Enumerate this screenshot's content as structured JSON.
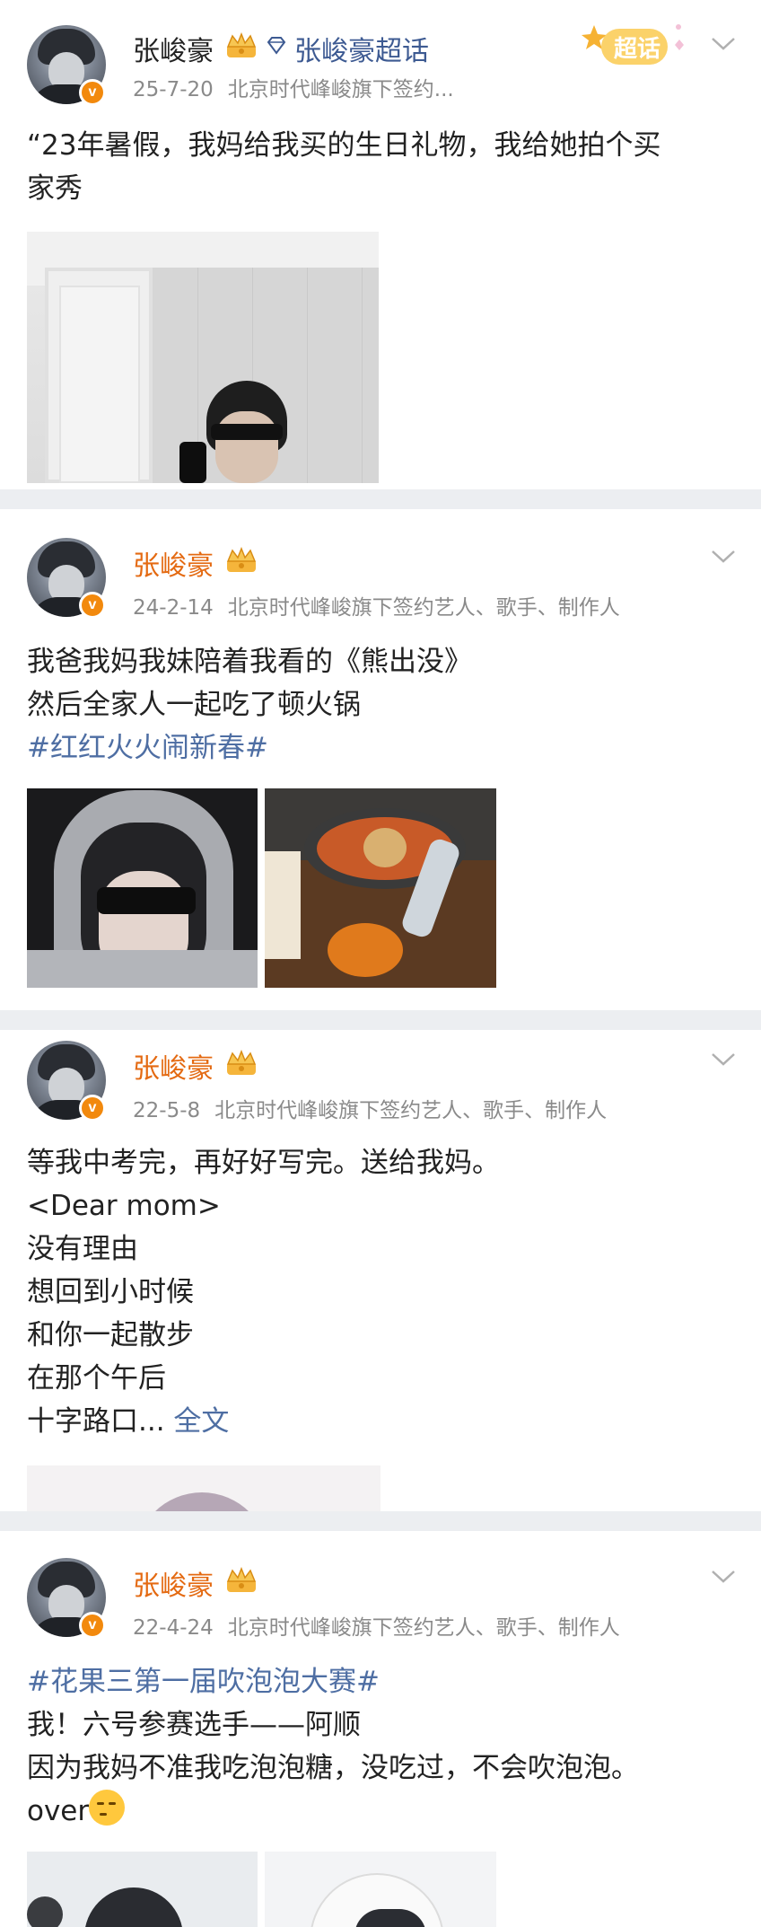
{
  "posts": [
    {
      "author": "张峻豪",
      "supertopic": "张峻豪超话",
      "sticker_label": "超话",
      "date": "25-7-20",
      "source": "北京时代峰峻旗下签约...",
      "lines": [
        "“23年暑假，我妈给我买的生日礼物，我给她拍个买",
        "家秀"
      ]
    },
    {
      "author": "张峻豪",
      "date": "24-2-14",
      "source": "北京时代峰峻旗下签约艺人、歌手、制作人",
      "lines": [
        "我爸我妈我妹陪着我看的《熊出没》",
        "然后全家人一起吃了顿火锅"
      ],
      "hashtag": "#红红火火闹新春#"
    },
    {
      "author": "张峻豪",
      "date": "22-5-8",
      "source": "北京时代峰峻旗下签约艺人、歌手、制作人",
      "lines": [
        "等我中考完，再好好写完。送给我妈。",
        "<Dear mom>",
        "没有理由",
        "想回到小时候",
        "和你一起散步",
        "在那个午后"
      ],
      "last_line": "十字路口...",
      "more_label": "全文"
    },
    {
      "author": "张峻豪",
      "date": "22-4-24",
      "source": "北京时代峰峻旗下签约艺人、歌手、制作人",
      "hashtag": "#花果三第一届吹泡泡大赛#",
      "lines": [
        "我！六号参赛选手——阿顺",
        "因为我妈不准我吃泡泡糖，没吃过，不会吹泡泡。"
      ],
      "last_line": "over"
    }
  ],
  "colors": {
    "link": "#4e6ea3",
    "author_orange": "#e46a12",
    "meta_gray": "#8a8a8a",
    "separator": "#eceef1"
  }
}
